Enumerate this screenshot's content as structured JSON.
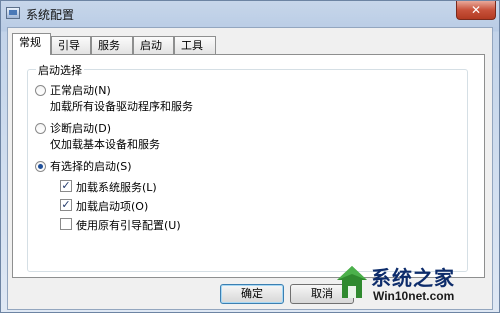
{
  "window": {
    "title": "系统配置",
    "close_glyph": "✕"
  },
  "tabs": [
    {
      "label": "常规",
      "active": true
    },
    {
      "label": "引导",
      "active": false
    },
    {
      "label": "服务",
      "active": false
    },
    {
      "label": "启动",
      "active": false
    },
    {
      "label": "工具",
      "active": false
    }
  ],
  "startup": {
    "group_title": "启动选择",
    "normal": {
      "label": "正常启动(N)",
      "desc": "加载所有设备驱动程序和服务",
      "selected": false
    },
    "diagnostic": {
      "label": "诊断启动(D)",
      "desc": "仅加载基本设备和服务",
      "selected": false
    },
    "selective": {
      "label": "有选择的启动(S)",
      "selected": true
    },
    "options": [
      {
        "label": "加载系统服务(L)",
        "checked": true
      },
      {
        "label": "加载启动项(O)",
        "checked": true
      },
      {
        "label": "使用原有引导配置(U)",
        "checked": false
      }
    ]
  },
  "buttons": {
    "ok": "确定",
    "cancel": "取消"
  },
  "watermark": {
    "name": "系统之家",
    "site": "Win10net.com"
  },
  "colors": {
    "accent": "#1f4f99",
    "close": "#c8523b",
    "watermark_text": "#0d2c6b"
  }
}
